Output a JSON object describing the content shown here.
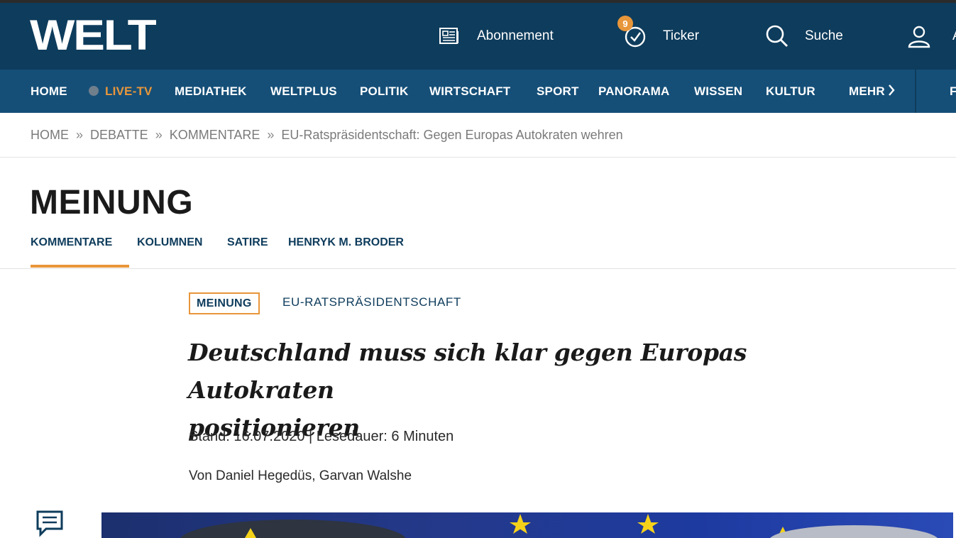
{
  "header": {
    "logo": "WELT",
    "abo_label": "Abonnement",
    "ticker_label": "Ticker",
    "ticker_count": "9",
    "search_label": "Suche",
    "user_label_partial": "A"
  },
  "nav": {
    "items": [
      "HOME",
      "LIVE-TV",
      "MEDIATHEK",
      "WELTPLUS",
      "POLITIK",
      "WIRTSCHAFT",
      "SPORT",
      "PANORAMA",
      "WISSEN",
      "KULTUR",
      "MEHR"
    ],
    "overflow_partial": "F"
  },
  "breadcrumb": {
    "items": [
      "HOME",
      "DEBATTE",
      "KOMMENTARE",
      "EU-Ratspräsidentschaft: Gegen Europas Autokraten wehren"
    ],
    "separator": "»"
  },
  "section": {
    "title": "MEINUNG",
    "subnav": [
      "KOMMENTARE",
      "KOLUMNEN",
      "SATIRE",
      "HENRYK M. BRODER"
    ],
    "active_subnav": "KOMMENTARE"
  },
  "article": {
    "badge": "MEINUNG",
    "topic": "EU-RATSPRÄSIDENTSCHAFT",
    "headline_line1": "Deutschland muss sich klar gegen Europas Autokraten",
    "headline_line2": "positionieren",
    "meta": "Stand: 16.07.2020 | Lesedauer: 6 Minuten",
    "author": "Von Daniel Hegedüs, Garvan Walshe"
  },
  "colors": {
    "header_bg": "#0e3c5c",
    "nav_bg": "#154f78",
    "accent": "#e8963a",
    "text_dark": "#1a1a1a"
  },
  "icons": [
    "newspaper-icon",
    "clock-check-icon",
    "search-icon",
    "user-icon",
    "chevron-right-icon",
    "comment-icon"
  ]
}
